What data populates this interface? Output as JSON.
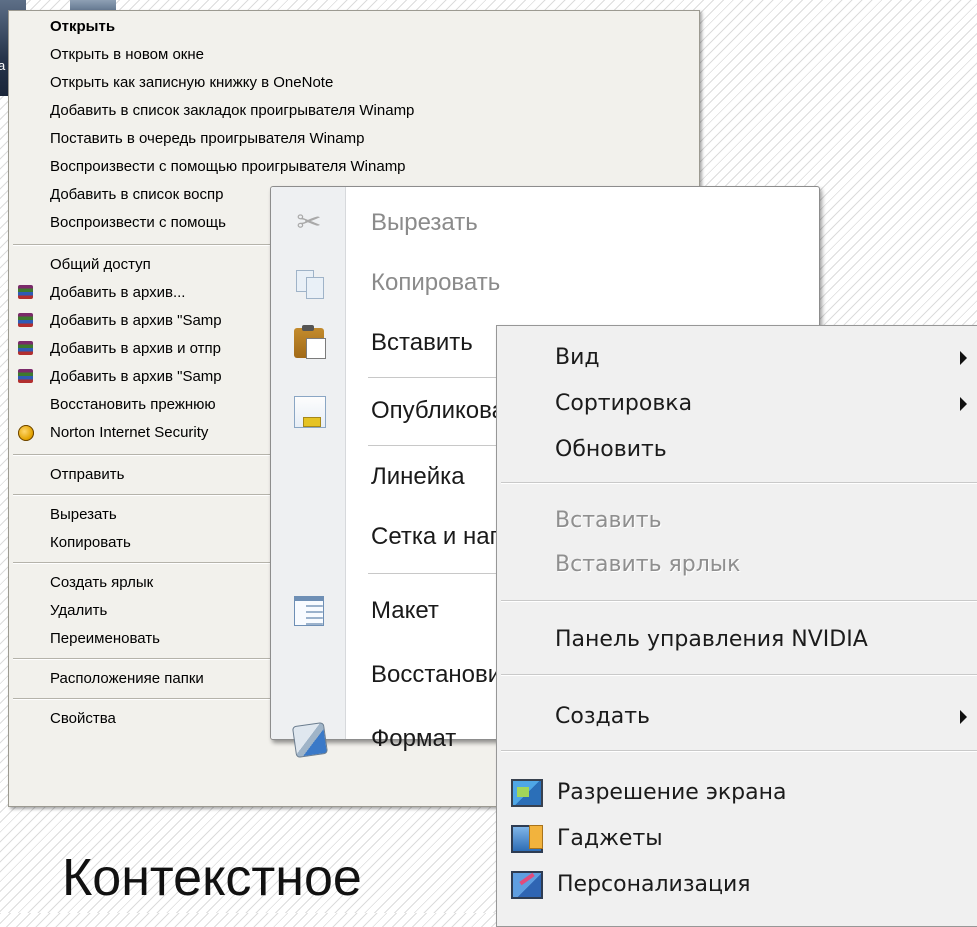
{
  "caption": "Контекстное",
  "menu1": {
    "items": [
      {
        "label": "Открыть",
        "bold": true
      },
      {
        "label": "Открыть в новом окне"
      },
      {
        "label": "Открыть как записную книжку в OneNote"
      },
      {
        "label": "Добавить в список закладок проигрывателя Winamp"
      },
      {
        "label": "Поставить в очередь проигрывателя Winamp"
      },
      {
        "label": "Воспроизвести с помощью проигрывателя Winamp"
      },
      {
        "label": "Добавить в список воспр"
      },
      {
        "label": "Воспроизвести с помощь"
      },
      {
        "label": "Общий доступ"
      },
      {
        "label": "Добавить в архив...",
        "icon": "winrar-icon"
      },
      {
        "label": "Добавить в архив \"Samp",
        "icon": "winrar-icon"
      },
      {
        "label": "Добавить в архив и отпр",
        "icon": "winrar-icon"
      },
      {
        "label": "Добавить в архив \"Samp",
        "icon": "winrar-icon"
      },
      {
        "label": "Восстановить прежнюю"
      },
      {
        "label": "Norton Internet Security",
        "icon": "norton-icon"
      },
      {
        "label": "Отправить"
      },
      {
        "label": "Вырезать"
      },
      {
        "label": "Копировать"
      },
      {
        "label": "Создать ярлык"
      },
      {
        "label": "Удалить"
      },
      {
        "label": "Переименовать"
      },
      {
        "label": "Расположенияе папки"
      },
      {
        "label": "Свойства"
      }
    ]
  },
  "menu2": {
    "items": [
      {
        "label": "Вырезать",
        "disabled": true,
        "icon": "scissors-icon"
      },
      {
        "label": "Копировать",
        "disabled": true,
        "icon": "copy-icon"
      },
      {
        "label": "Вставить",
        "icon": "paste-icon"
      },
      {
        "label": "Опубликовать",
        "icon": "publish-icon"
      },
      {
        "label": "Линейка"
      },
      {
        "label": "Сетка и направляющие"
      },
      {
        "label": "Макет",
        "icon": "layout-icon"
      },
      {
        "label": "Восстановить"
      },
      {
        "label": "Формат",
        "icon": "format-icon"
      }
    ]
  },
  "menu3": {
    "items": [
      {
        "label": "Вид",
        "submenu": true
      },
      {
        "label": "Сортировка",
        "submenu": true
      },
      {
        "label": "Обновить"
      },
      {
        "label": "Вставить",
        "disabled": true
      },
      {
        "label": "Вставить ярлык",
        "disabled": true
      },
      {
        "label": "Панель управления NVIDIA"
      },
      {
        "label": "Создать",
        "submenu": true
      },
      {
        "label": "Разрешение экрана",
        "icon": "screen-resolution-icon"
      },
      {
        "label": "Гаджеты",
        "icon": "gadgets-icon"
      },
      {
        "label": "Персонализация",
        "icon": "personalization-icon"
      }
    ]
  }
}
